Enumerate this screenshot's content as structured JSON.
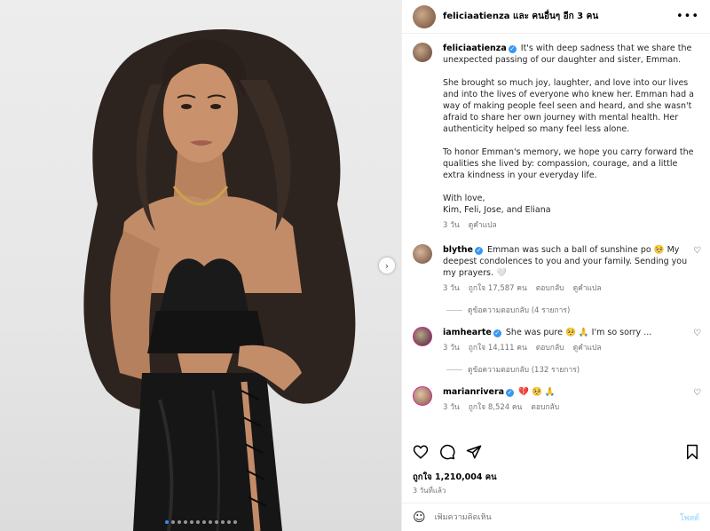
{
  "header": {
    "title": "feliciaatienza และ คนอื่นๆ อีก 3 คน"
  },
  "caption": {
    "username": "feliciaatienza",
    "first_line": "It's with deep sadness that we share the unexpected passing of our daughter and sister, Emman.",
    "para2": "She brought so much joy, laughter, and love into our lives and into the lives of everyone who knew her. Emman had a way of making people feel seen and heard, and she wasn't afraid to share her own journey with mental health. Her authenticity helped so many feel less alone.",
    "para3": "To honor Emman's memory, we hope you carry forward the qualities she lived by: compassion, courage, and a little extra kindness in your everyday life.",
    "signoff1": "With love,",
    "signoff2": "Kim, Feli, Jose, and Eliana",
    "time": "3 วัน",
    "translate": "ดูคำแปล"
  },
  "comments": [
    {
      "username": "blythe",
      "text": "Emman was such a ball of sunshine po 🥺 My deepest condolences to you and your family. Sending you my prayers. 🤍",
      "time": "3 วัน",
      "likes": "ถูกใจ 17,587 คน",
      "reply": "ตอบกลับ",
      "translate": "ดูคำแปล",
      "view_replies": "ดูข้อความตอบกลับ (4 รายการ)"
    },
    {
      "username": "iamhearte",
      "text": "She was pure 🥺 🙏 I'm so sorry ...",
      "time": "3 วัน",
      "likes": "ถูกใจ 14,111 คน",
      "reply": "ตอบกลับ",
      "translate": "ดูคำแปล",
      "view_replies": "ดูข้อความตอบกลับ (132 รายการ)"
    },
    {
      "username": "marianrivera",
      "text": "💔 🥺 🙏",
      "time": "3 วัน",
      "likes": "ถูกใจ 8,524 คน",
      "reply": "ตอบกลับ"
    }
  ],
  "likes_total": "ถูกใจ 1,210,004 คน",
  "post_time": "3 วันที่แล้ว",
  "add_comment": {
    "placeholder": "เพิ่มความคิดเห็น",
    "post_label": "โพสต์"
  },
  "carousel": {
    "slides": 12,
    "active_index": 0
  },
  "colors": {
    "accent": "#3797f0",
    "post_button": "#b2dffc",
    "meta": "#737373"
  }
}
